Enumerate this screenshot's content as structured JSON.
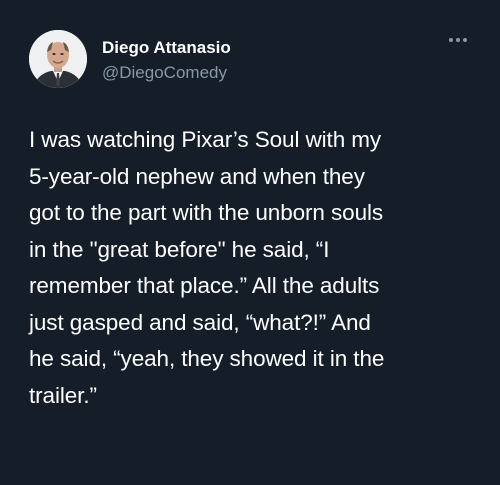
{
  "author": {
    "display_name": "Diego Attanasio",
    "handle": "@DiegoComedy",
    "avatar_icon": "profile-photo"
  },
  "menu_icon": "more-dots-icon",
  "tweet": {
    "lines": [
      "I was watching Pixar’s Soul with my",
      "5-year-old nephew and when they",
      "got to the part with the unborn souls",
      "in the \"great before\" he said, “I",
      "remember that place.” All the adults",
      "just gasped and said, “what?!” And",
      "he said, “yeah, they showed it in the",
      "trailer.”"
    ]
  },
  "colors": {
    "background": "#141d28",
    "text": "#ffffff",
    "secondary_text": "#8899a6"
  }
}
